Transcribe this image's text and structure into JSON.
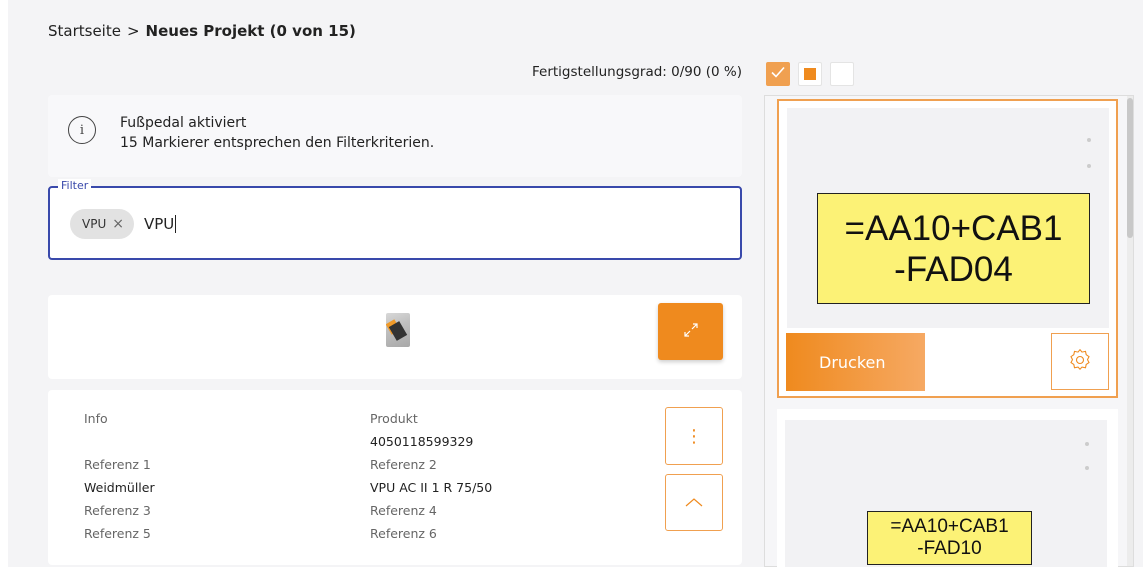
{
  "breadcrumb": {
    "home": "Startseite",
    "separator": ">",
    "current": "Neues Projekt (0 von 15)"
  },
  "progress": {
    "label": "Fertigstellungsgrad: 0/90 (0 %)",
    "completed": 0,
    "total": 90,
    "percent": 0
  },
  "view_toggles": {
    "icons": [
      "check-icon",
      "filled-square-icon",
      "empty-square-icon"
    ],
    "active": "check-icon"
  },
  "info": {
    "title": "Fußpedal aktiviert",
    "message": "15 Markierer entsprechen den Filterkriterien."
  },
  "filter": {
    "label": "Filter",
    "chip": "VPU",
    "value": "VPU"
  },
  "details": {
    "col1": [
      {
        "label": "Info",
        "value": ""
      },
      {
        "label": "Referenz 1",
        "value": "Weidmüller"
      },
      {
        "label": "Referenz 3",
        "value": ""
      },
      {
        "label": "Referenz 5",
        "value": ""
      }
    ],
    "col2": [
      {
        "label": "Produkt",
        "value": "4050118599329"
      },
      {
        "label": "Referenz 2",
        "value": "VPU AC II 1 R 75/50"
      },
      {
        "label": "Referenz 4",
        "value": ""
      },
      {
        "label": "Referenz 6",
        "value": ""
      }
    ]
  },
  "markers": [
    {
      "line1": "=AA10+CAB1",
      "line2": "-FAD04"
    },
    {
      "line1": "=AA10+CAB1",
      "line2": "-FAD10"
    }
  ],
  "actions": {
    "print_label": "Drucken"
  },
  "colors": {
    "accent": "#ef8a1e",
    "focus": "#3949ab",
    "label_bg": "#fcf276"
  }
}
